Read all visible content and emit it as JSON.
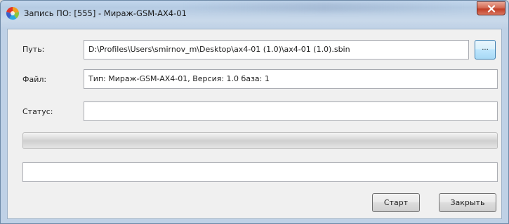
{
  "window": {
    "title": "Запись ПО: [555] - Мираж-GSM-AX4-01",
    "close_label": "x"
  },
  "form": {
    "path_label": "Путь:",
    "path_value": "D:\\Profiles\\Users\\smirnov_m\\Desktop\\ax4-01 (1.0)\\ax4-01 (1.0).sbin",
    "browse_label": "...",
    "file_label": "Файл:",
    "file_value": "Тип: Мираж-GSM-AX4-01, Версия: 1.0 база: 1",
    "status_label": "Статус:",
    "status_value": "",
    "progress_percent": 0,
    "message_value": ""
  },
  "buttons": {
    "start_label": "Старт",
    "close_label": "Закрыть"
  },
  "colors": {
    "accent": "#3c7fb1",
    "close_button": "#c13f27"
  }
}
